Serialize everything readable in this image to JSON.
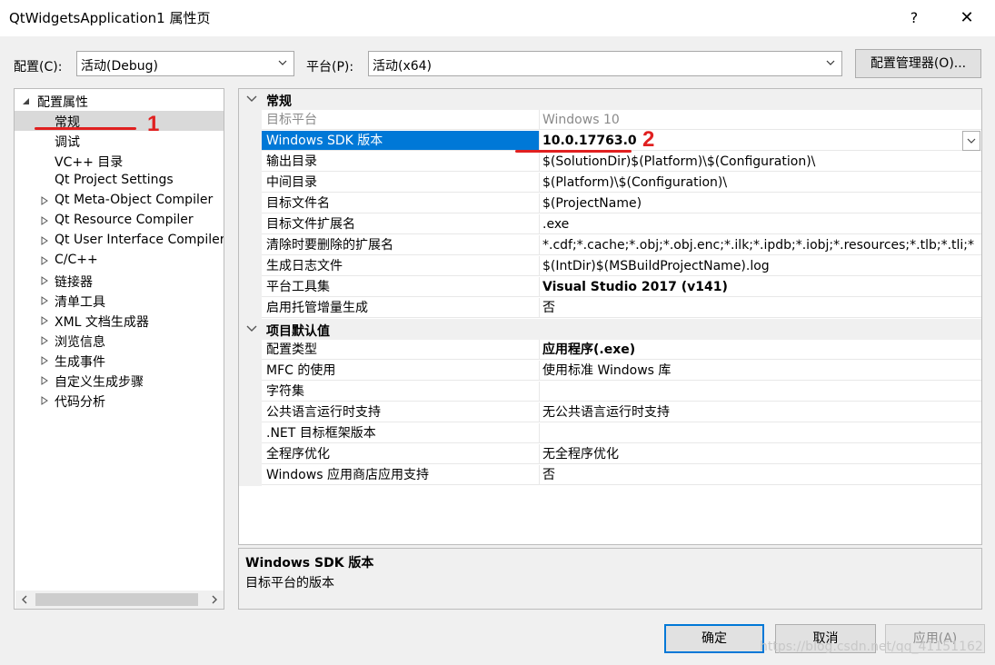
{
  "window": {
    "title": "QtWidgetsApplication1 属性页",
    "help": "?",
    "close": "✕"
  },
  "toolbar": {
    "config_label": "配置(C):",
    "config_value": "活动(Debug)",
    "platform_label": "平台(P):",
    "platform_value": "活动(x64)",
    "manager_button": "配置管理器(O)..."
  },
  "tree": {
    "root": "配置属性",
    "items": [
      {
        "label": "常规",
        "expandable": false
      },
      {
        "label": "调试",
        "expandable": false
      },
      {
        "label": "VC++ 目录",
        "expandable": false
      },
      {
        "label": "Qt Project Settings",
        "expandable": false
      },
      {
        "label": "Qt Meta-Object Compiler",
        "expandable": true
      },
      {
        "label": "Qt Resource Compiler",
        "expandable": true
      },
      {
        "label": "Qt User Interface Compiler",
        "expandable": true
      },
      {
        "label": "C/C++",
        "expandable": true
      },
      {
        "label": "链接器",
        "expandable": true
      },
      {
        "label": "清单工具",
        "expandable": true
      },
      {
        "label": "XML 文档生成器",
        "expandable": true
      },
      {
        "label": "浏览信息",
        "expandable": true
      },
      {
        "label": "生成事件",
        "expandable": true
      },
      {
        "label": "自定义生成步骤",
        "expandable": true
      },
      {
        "label": "代码分析",
        "expandable": true
      }
    ]
  },
  "grid": {
    "categories": [
      {
        "name": "常规",
        "rows": [
          {
            "name": "目标平台",
            "value": "Windows 10"
          },
          {
            "name": "Windows SDK 版本",
            "value": "10.0.17763.0"
          },
          {
            "name": "输出目录",
            "value": "$(SolutionDir)$(Platform)\\$(Configuration)\\"
          },
          {
            "name": "中间目录",
            "value": "$(Platform)\\$(Configuration)\\"
          },
          {
            "name": "目标文件名",
            "value": "$(ProjectName)"
          },
          {
            "name": "目标文件扩展名",
            "value": ".exe"
          },
          {
            "name": "清除时要删除的扩展名",
            "value": "*.cdf;*.cache;*.obj;*.obj.enc;*.ilk;*.ipdb;*.iobj;*.resources;*.tlb;*.tli;*"
          },
          {
            "name": "生成日志文件",
            "value": "$(IntDir)$(MSBuildProjectName).log"
          },
          {
            "name": "平台工具集",
            "value": "Visual Studio 2017 (v141)"
          },
          {
            "name": "启用托管增量生成",
            "value": "否"
          }
        ]
      },
      {
        "name": "项目默认值",
        "rows": [
          {
            "name": "配置类型",
            "value": "应用程序(.exe)"
          },
          {
            "name": "MFC 的使用",
            "value": "使用标准 Windows 库"
          },
          {
            "name": "字符集",
            "value": ""
          },
          {
            "name": "公共语言运行时支持",
            "value": "无公共语言运行时支持"
          },
          {
            "name": ".NET 目标框架版本",
            "value": ""
          },
          {
            "name": "全程序优化",
            "value": "无全程序优化"
          },
          {
            "name": "Windows 应用商店应用支持",
            "value": "否"
          }
        ]
      }
    ]
  },
  "description": {
    "title": "Windows SDK 版本",
    "text": "目标平台的版本"
  },
  "annotations": {
    "one": "1",
    "two": "2",
    "color": "#e02020"
  },
  "buttons": {
    "ok": "确定",
    "cancel": "取消",
    "apply": "应用(A)"
  },
  "watermark": "https://blog.csdn.net/qq_41151162",
  "colors": {
    "selection": "#0078d7",
    "accent": "#0078d7"
  }
}
